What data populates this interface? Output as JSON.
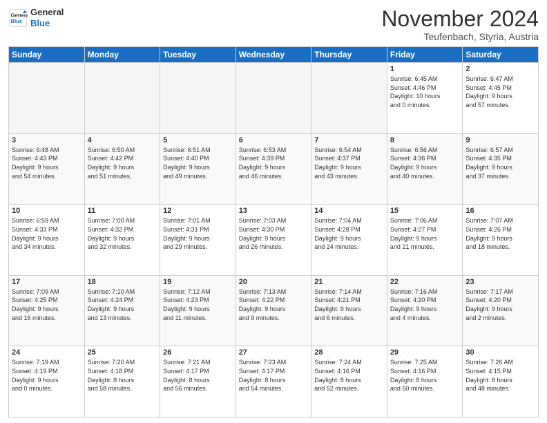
{
  "header": {
    "logo_line1": "General",
    "logo_line2": "Blue",
    "month": "November 2024",
    "location": "Teufenbach, Styria, Austria"
  },
  "days_of_week": [
    "Sunday",
    "Monday",
    "Tuesday",
    "Wednesday",
    "Thursday",
    "Friday",
    "Saturday"
  ],
  "weeks": [
    [
      {
        "day": "",
        "info": "",
        "empty": true
      },
      {
        "day": "",
        "info": "",
        "empty": true
      },
      {
        "day": "",
        "info": "",
        "empty": true
      },
      {
        "day": "",
        "info": "",
        "empty": true
      },
      {
        "day": "",
        "info": "",
        "empty": true
      },
      {
        "day": "1",
        "info": "Sunrise: 6:45 AM\nSunset: 4:46 PM\nDaylight: 10 hours\nand 0 minutes."
      },
      {
        "day": "2",
        "info": "Sunrise: 6:47 AM\nSunset: 4:45 PM\nDaylight: 9 hours\nand 57 minutes."
      }
    ],
    [
      {
        "day": "3",
        "info": "Sunrise: 6:48 AM\nSunset: 4:43 PM\nDaylight: 9 hours\nand 54 minutes."
      },
      {
        "day": "4",
        "info": "Sunrise: 6:50 AM\nSunset: 4:42 PM\nDaylight: 9 hours\nand 51 minutes."
      },
      {
        "day": "5",
        "info": "Sunrise: 6:51 AM\nSunset: 4:40 PM\nDaylight: 9 hours\nand 49 minutes."
      },
      {
        "day": "6",
        "info": "Sunrise: 6:53 AM\nSunset: 4:39 PM\nDaylight: 9 hours\nand 46 minutes."
      },
      {
        "day": "7",
        "info": "Sunrise: 6:54 AM\nSunset: 4:37 PM\nDaylight: 9 hours\nand 43 minutes."
      },
      {
        "day": "8",
        "info": "Sunrise: 6:56 AM\nSunset: 4:36 PM\nDaylight: 9 hours\nand 40 minutes."
      },
      {
        "day": "9",
        "info": "Sunrise: 6:57 AM\nSunset: 4:35 PM\nDaylight: 9 hours\nand 37 minutes."
      }
    ],
    [
      {
        "day": "10",
        "info": "Sunrise: 6:59 AM\nSunset: 4:33 PM\nDaylight: 9 hours\nand 34 minutes."
      },
      {
        "day": "11",
        "info": "Sunrise: 7:00 AM\nSunset: 4:32 PM\nDaylight: 9 hours\nand 32 minutes."
      },
      {
        "day": "12",
        "info": "Sunrise: 7:01 AM\nSunset: 4:31 PM\nDaylight: 9 hours\nand 29 minutes."
      },
      {
        "day": "13",
        "info": "Sunrise: 7:03 AM\nSunset: 4:30 PM\nDaylight: 9 hours\nand 26 minutes."
      },
      {
        "day": "14",
        "info": "Sunrise: 7:04 AM\nSunset: 4:28 PM\nDaylight: 9 hours\nand 24 minutes."
      },
      {
        "day": "15",
        "info": "Sunrise: 7:06 AM\nSunset: 4:27 PM\nDaylight: 9 hours\nand 21 minutes."
      },
      {
        "day": "16",
        "info": "Sunrise: 7:07 AM\nSunset: 4:26 PM\nDaylight: 9 hours\nand 18 minutes."
      }
    ],
    [
      {
        "day": "17",
        "info": "Sunrise: 7:09 AM\nSunset: 4:25 PM\nDaylight: 9 hours\nand 16 minutes."
      },
      {
        "day": "18",
        "info": "Sunrise: 7:10 AM\nSunset: 4:24 PM\nDaylight: 9 hours\nand 13 minutes."
      },
      {
        "day": "19",
        "info": "Sunrise: 7:12 AM\nSunset: 4:23 PM\nDaylight: 9 hours\nand 11 minutes."
      },
      {
        "day": "20",
        "info": "Sunrise: 7:13 AM\nSunset: 4:22 PM\nDaylight: 9 hours\nand 9 minutes."
      },
      {
        "day": "21",
        "info": "Sunrise: 7:14 AM\nSunset: 4:21 PM\nDaylight: 9 hours\nand 6 minutes."
      },
      {
        "day": "22",
        "info": "Sunrise: 7:16 AM\nSunset: 4:20 PM\nDaylight: 9 hours\nand 4 minutes."
      },
      {
        "day": "23",
        "info": "Sunrise: 7:17 AM\nSunset: 4:20 PM\nDaylight: 9 hours\nand 2 minutes."
      }
    ],
    [
      {
        "day": "24",
        "info": "Sunrise: 7:19 AM\nSunset: 4:19 PM\nDaylight: 9 hours\nand 0 minutes."
      },
      {
        "day": "25",
        "info": "Sunrise: 7:20 AM\nSunset: 4:18 PM\nDaylight: 8 hours\nand 58 minutes."
      },
      {
        "day": "26",
        "info": "Sunrise: 7:21 AM\nSunset: 4:17 PM\nDaylight: 8 hours\nand 56 minutes."
      },
      {
        "day": "27",
        "info": "Sunrise: 7:23 AM\nSunset: 4:17 PM\nDaylight: 8 hours\nand 54 minutes."
      },
      {
        "day": "28",
        "info": "Sunrise: 7:24 AM\nSunset: 4:16 PM\nDaylight: 8 hours\nand 52 minutes."
      },
      {
        "day": "29",
        "info": "Sunrise: 7:25 AM\nSunset: 4:16 PM\nDaylight: 8 hours\nand 50 minutes."
      },
      {
        "day": "30",
        "info": "Sunrise: 7:26 AM\nSunset: 4:15 PM\nDaylight: 8 hours\nand 48 minutes."
      }
    ]
  ]
}
